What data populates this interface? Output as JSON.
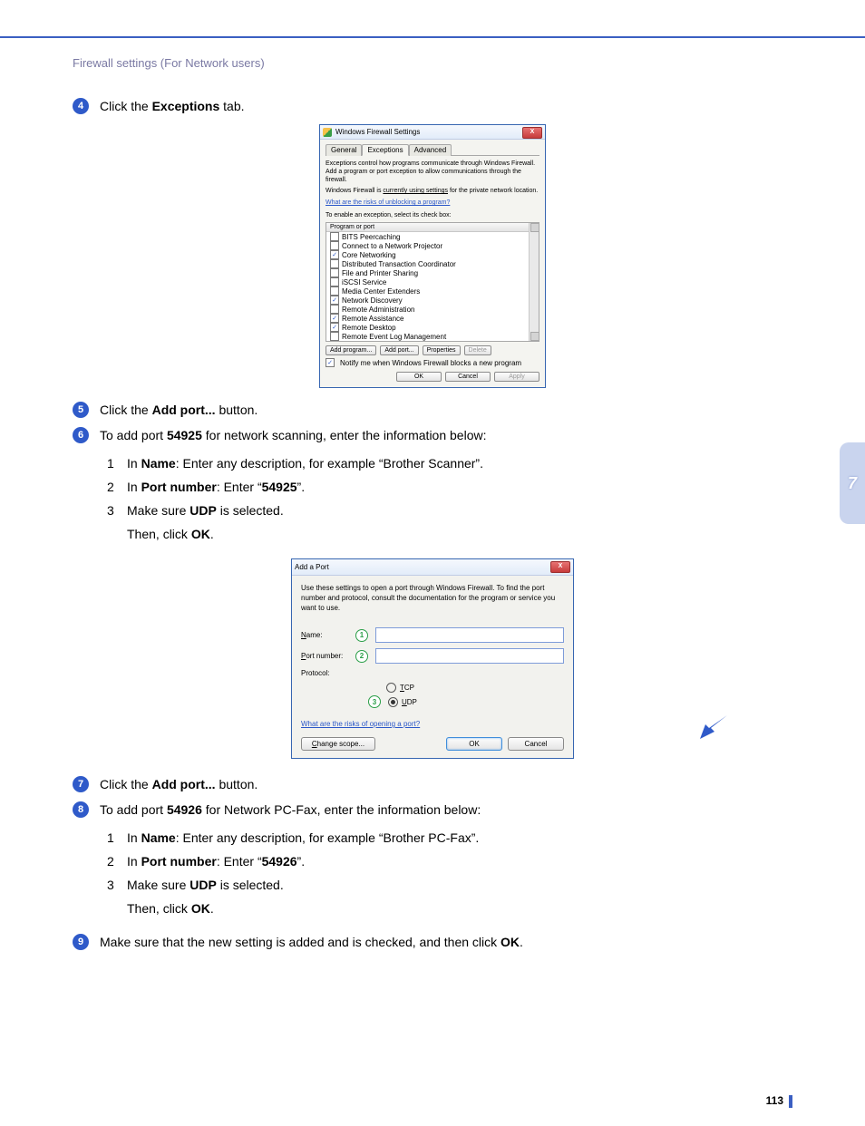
{
  "header": "Firewall settings (For Network users)",
  "sidetab": "7",
  "page_number": "113",
  "steps": {
    "s4": {
      "num": "4",
      "prefix": "Click the ",
      "bold": "Exceptions",
      "suffix": " tab."
    },
    "s5": {
      "num": "5",
      "prefix": "Click the ",
      "bold": "Add port...",
      "suffix": " button."
    },
    "s6": {
      "num": "6",
      "prefix": "To add port ",
      "bold": "54925",
      "suffix": " for network scanning, enter the information below:",
      "sub1_num": "1",
      "sub1_a": "In ",
      "sub1_b": "Name",
      "sub1_c": ": Enter any description, for example “Brother Scanner”.",
      "sub2_num": "2",
      "sub2_a": "In ",
      "sub2_b": "Port number",
      "sub2_c": ": Enter “",
      "sub2_d": "54925",
      "sub2_e": "”.",
      "sub3_num": "3",
      "sub3_a": "Make sure ",
      "sub3_b": "UDP",
      "sub3_c": " is selected.",
      "sub3_then_a": "Then, click ",
      "sub3_then_b": "OK",
      "sub3_then_c": "."
    },
    "s7": {
      "num": "7",
      "prefix": "Click the ",
      "bold": "Add port...",
      "suffix": " button."
    },
    "s8": {
      "num": "8",
      "prefix": "To add port ",
      "bold": "54926",
      "suffix": " for Network PC-Fax, enter the information below:",
      "sub1_num": "1",
      "sub1_a": "In ",
      "sub1_b": "Name",
      "sub1_c": ": Enter any description, for example “Brother PC-Fax”.",
      "sub2_num": "2",
      "sub2_a": "In ",
      "sub2_b": "Port number",
      "sub2_c": ": Enter “",
      "sub2_d": "54926",
      "sub2_e": "”.",
      "sub3_num": "3",
      "sub3_a": "Make sure ",
      "sub3_b": "UDP",
      "sub3_c": " is selected.",
      "sub3_then_a": "Then, click ",
      "sub3_then_b": "OK",
      "sub3_then_c": "."
    },
    "s9": {
      "num": "9",
      "prefix": "Make sure that the new setting is added and is checked, and then click ",
      "bold": "OK",
      "suffix": "."
    }
  },
  "dialog1": {
    "title": "Windows Firewall Settings",
    "close": "X",
    "tabs": {
      "general": "General",
      "exceptions": "Exceptions",
      "advanced": "Advanced"
    },
    "para1": "Exceptions control how programs communicate through Windows Firewall. Add a program or port exception to allow communications through the firewall.",
    "para2a": "Windows Firewall is ",
    "para2b": "currently using settings",
    "para2c": " for the private network location.",
    "risks_link": "What are the risks of unblocking a program?",
    "enable_text": "To enable an exception, select its check box:",
    "list_header": "Program or port",
    "rows": [
      {
        "checked": false,
        "label": "BITS Peercaching"
      },
      {
        "checked": false,
        "label": "Connect to a Network Projector"
      },
      {
        "checked": true,
        "label": "Core Networking"
      },
      {
        "checked": false,
        "label": "Distributed Transaction Coordinator"
      },
      {
        "checked": false,
        "label": "File and Printer Sharing"
      },
      {
        "checked": false,
        "label": "iSCSI Service"
      },
      {
        "checked": false,
        "label": "Media Center Extenders"
      },
      {
        "checked": true,
        "label": "Network Discovery"
      },
      {
        "checked": false,
        "label": "Remote Administration"
      },
      {
        "checked": true,
        "label": "Remote Assistance"
      },
      {
        "checked": true,
        "label": "Remote Desktop"
      },
      {
        "checked": false,
        "label": "Remote Event Log Management"
      }
    ],
    "buttons": {
      "add_program": "Add program...",
      "add_port": "Add port...",
      "properties": "Properties",
      "delete": "Delete"
    },
    "notify": "Notify me when Windows Firewall blocks a new program",
    "ok": "OK",
    "cancel": "Cancel",
    "apply": "Apply"
  },
  "dialog2": {
    "title": "Add a Port",
    "close": "X",
    "desc": "Use these settings to open a port through Windows Firewall. To find the port number and protocol, consult the documentation for the program or service you want to use.",
    "name_label": "Name:",
    "port_label": "Port number:",
    "proto_label": "Protocol:",
    "tcp": "TCP",
    "udp": "UDP",
    "circle1": "1",
    "circle2": "2",
    "circle3": "3",
    "risks_link": "What are the risks of opening a port?",
    "change_scope": "Change scope...",
    "ok": "OK",
    "cancel": "Cancel"
  }
}
